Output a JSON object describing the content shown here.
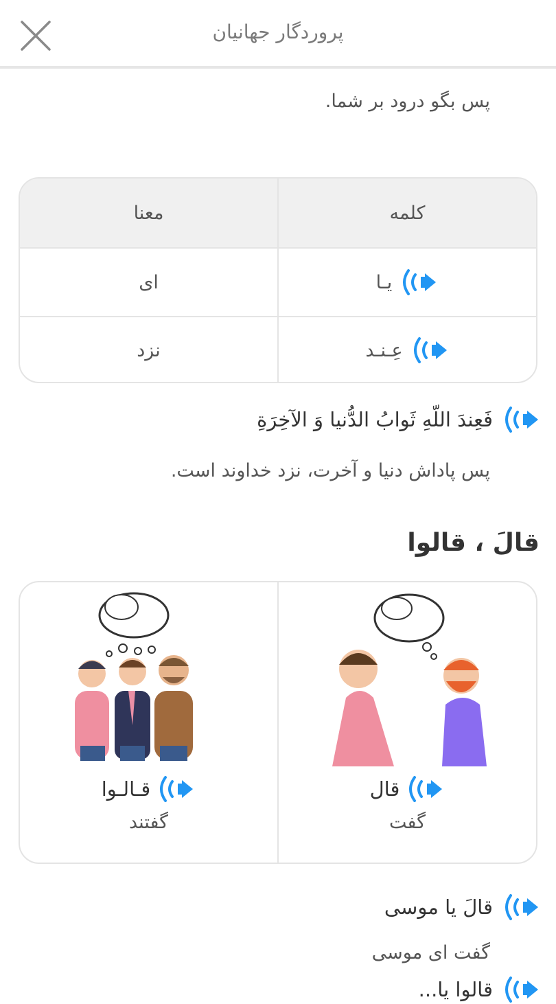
{
  "header": {
    "title": "پروردگار جهانیان",
    "close_icon": "close-icon"
  },
  "intro_line": "پس بگو درود بر شما.",
  "vocab_table": {
    "headers": {
      "word": "کلمه",
      "meaning": "معنا"
    },
    "rows": [
      {
        "word": "یـا",
        "meaning": "ای"
      },
      {
        "word": "عِـنـد",
        "meaning": "نزد"
      }
    ]
  },
  "sentence1": {
    "arabic": "فَعِندَ اللّهِ ثَوابُ الدُّنيا وَ الآخِرَةِ",
    "translation": "پس پاداش دنیا و آخرت، نزد خداوند است."
  },
  "section": {
    "title": "قالَ ، قالوا",
    "cards": [
      {
        "word": "قال",
        "meaning": "گفت"
      },
      {
        "word": "قـالـوا",
        "meaning": "گفتند"
      }
    ]
  },
  "sentence2": {
    "arabic": "قالَ يا موسى",
    "translation": "گفت ای موسی",
    "next_partial": "قالوا يا..."
  },
  "colors": {
    "accent": "#2196f3",
    "border": "#e4e4e4",
    "header_bg": "#f0f0f0"
  }
}
